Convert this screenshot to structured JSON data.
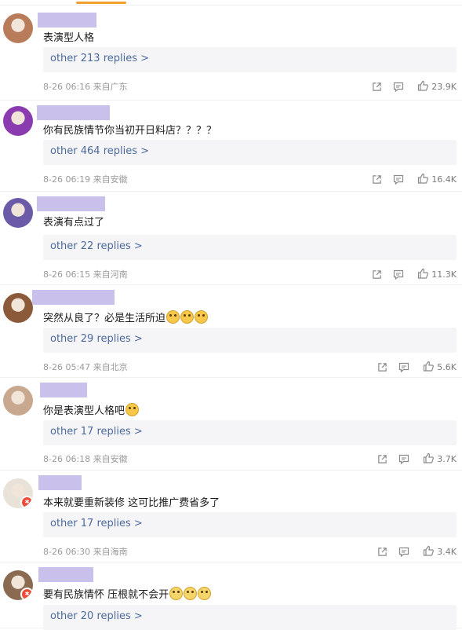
{
  "comments": [
    {
      "text": "表演型人格",
      "replies": "other 213 replies >",
      "meta": "8-26 06:16 来自广东",
      "likes": "23.9K",
      "emojis": 0,
      "avatar_color": "#b87c5a",
      "badge": false
    },
    {
      "text": "你有民族情节你当初开日料店？？？？",
      "replies": "other 464 replies >",
      "meta": "8-26 06:19 来自安徽",
      "likes": "16.4K",
      "emojis": 0,
      "avatar_color": "#8a3bb0",
      "badge": false
    },
    {
      "text": "表演有点过了",
      "replies": "other 22 replies >",
      "meta": "8-26 06:15 来自河南",
      "likes": "11.3K",
      "emojis": 0,
      "avatar_color": "#6a5aa8",
      "badge": false
    },
    {
      "text": "突然从良了？必是生活所迫",
      "replies": "other 29 replies >",
      "meta": "8-26 05:47 来自北京",
      "likes": "5.6K",
      "emojis": 3,
      "avatar_color": "#8b5a3a",
      "badge": false
    },
    {
      "text": "你是表演型人格吧",
      "replies": "other 17 replies >",
      "meta": "8-26 06:18 来自安徽",
      "likes": "3.7K",
      "emojis": 1,
      "avatar_color": "#c9a890",
      "badge": false
    },
    {
      "text": "本来就要重新装修  这可比推广费省多了",
      "replies": "other 17 replies >",
      "meta": "8-26 06:30 来自海南",
      "likes": "3.4K",
      "emojis": 0,
      "avatar_color": "#e8e2d8",
      "badge": true
    },
    {
      "text": "要有民族情怀  压根就不会开",
      "replies": "other 20 replies >",
      "meta": "",
      "likes": "",
      "emojis": 3,
      "avatar_color": "#8a6a50",
      "badge": true
    }
  ],
  "icons": {
    "share": "share-icon",
    "comment": "comment-icon",
    "like": "thumbs-up-icon"
  },
  "colors": {
    "link": "#4c6a9c",
    "name_placeholder": "#c9c0ec",
    "reply_bg": "#f5f5f7",
    "accent": "#f0a030"
  }
}
